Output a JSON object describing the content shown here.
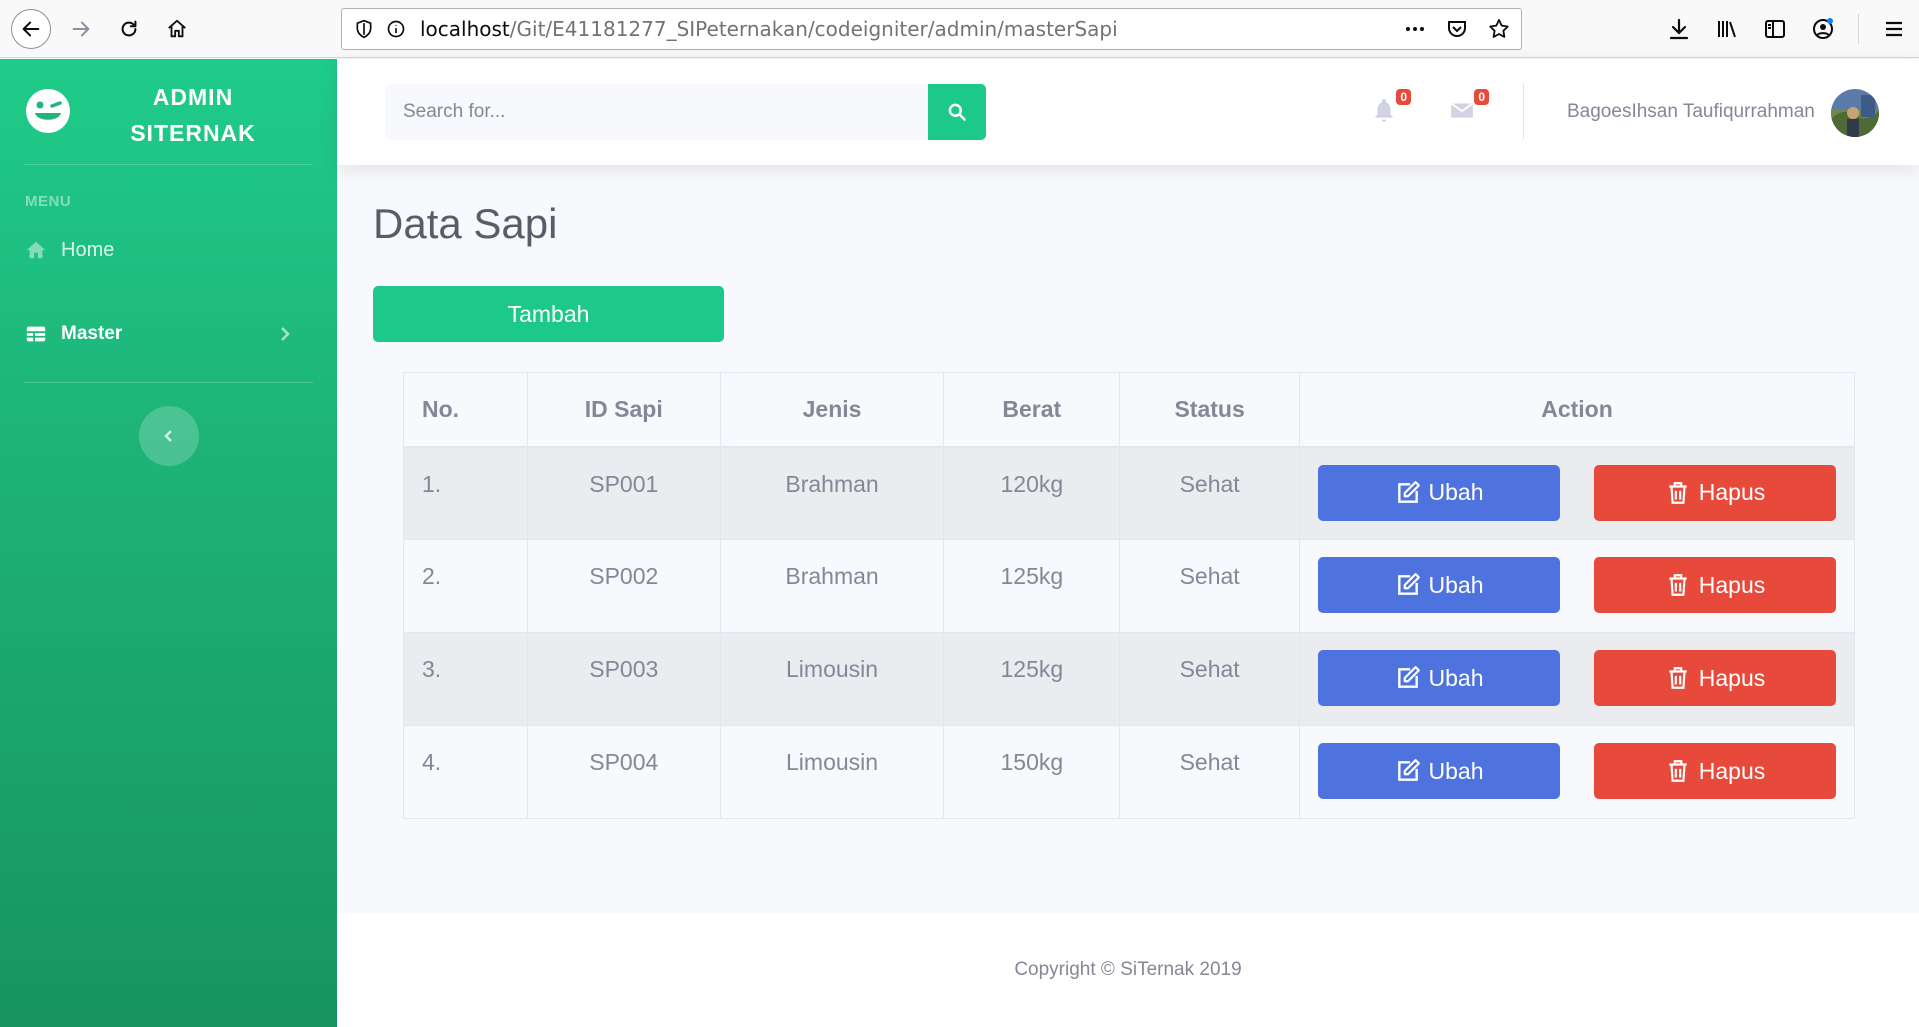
{
  "browser": {
    "url_host": "localhost",
    "url_path": "/Git/E41181277_SIPeternakan/codeigniter/admin/masterSapi"
  },
  "sidebar": {
    "brand_line1": "ADMIN",
    "brand_line2": "SITERNAK",
    "menu_heading": "MENU",
    "items": [
      {
        "label": "Home",
        "icon": "home-icon"
      },
      {
        "label": "Master",
        "icon": "table-icon"
      }
    ]
  },
  "topbar": {
    "search_placeholder": "Search for...",
    "alerts_count": "0",
    "messages_count": "0",
    "user_name": "BagoesIhsan Taufiqurrahman"
  },
  "page": {
    "title": "Data Sapi",
    "add_button": "Tambah"
  },
  "table": {
    "headers": [
      "No.",
      "ID Sapi",
      "Jenis",
      "Berat",
      "Status",
      "Action"
    ],
    "rows": [
      {
        "no": "1.",
        "id": "SP001",
        "jenis": "Brahman",
        "berat": "120kg",
        "status": "Sehat"
      },
      {
        "no": "2.",
        "id": "SP002",
        "jenis": "Brahman",
        "berat": "125kg",
        "status": "Sehat"
      },
      {
        "no": "3.",
        "id": "SP003",
        "jenis": "Limousin",
        "berat": "125kg",
        "status": "Sehat"
      },
      {
        "no": "4.",
        "id": "SP004",
        "jenis": "Limousin",
        "berat": "150kg",
        "status": "Sehat"
      }
    ],
    "edit_label": "Ubah",
    "delete_label": "Hapus"
  },
  "footer": {
    "copyright": "Copyright © SiTernak 2019"
  },
  "colors": {
    "primary_green": "#1cc88a",
    "edit_blue": "#4e73df",
    "delete_red": "#e74a3b"
  }
}
